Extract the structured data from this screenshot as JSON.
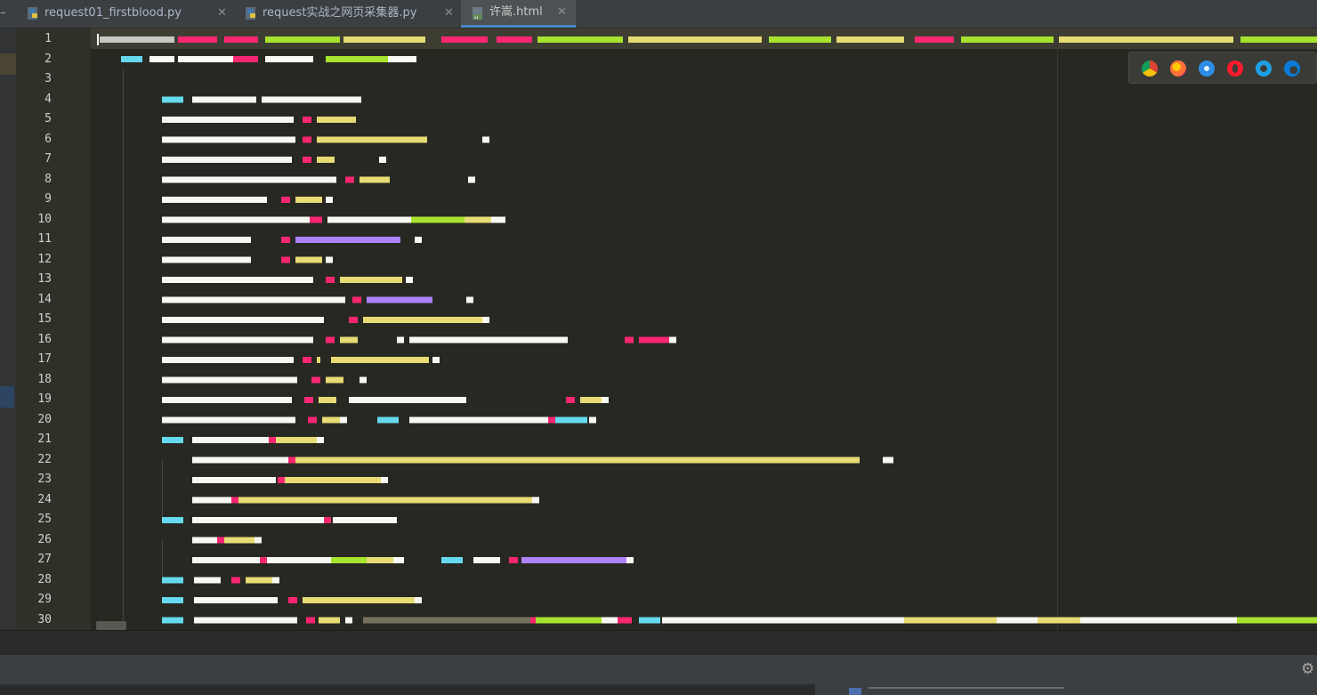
{
  "tabs": [
    {
      "label": "request01_firstblood.py",
      "type": "python",
      "active": false
    },
    {
      "label": "request实战之网页采集器.py",
      "type": "python",
      "active": false
    },
    {
      "label": "许嵩.html",
      "type": "html",
      "active": true
    }
  ],
  "editor": {
    "current_line": 1,
    "line_numbers": [
      "1",
      "2",
      "3",
      "4",
      "5",
      "6",
      "7",
      "8",
      "9",
      "10",
      "11",
      "12",
      "13",
      "14",
      "15",
      "16",
      "17",
      "18",
      "19",
      "20",
      "21",
      "22",
      "23",
      "24",
      "25",
      "26",
      "27",
      "28",
      "29",
      "30"
    ]
  },
  "browser_icons": [
    "chrome-icon",
    "firefox-icon",
    "safari-icon",
    "opera-icon",
    "internet-explorer-icon",
    "edge-icon"
  ],
  "colors": {
    "editor_background": "#272822",
    "keyword": "#f92672",
    "string": "#e6db74",
    "number": "#ae81ff",
    "function": "#a6e22e",
    "comment": "#75715e",
    "type": "#66d9ef"
  }
}
